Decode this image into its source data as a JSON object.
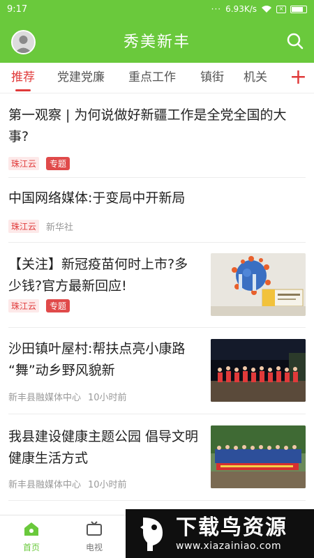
{
  "status": {
    "time": "9:17",
    "dots": "···",
    "network_speed": "6.93K/s",
    "sim_icon": "sim-x-icon",
    "battery_level": 0.85
  },
  "header": {
    "title": "秀美新丰",
    "avatar_icon": "avatar-icon",
    "search_icon": "search-icon"
  },
  "tabs": [
    {
      "label": "推荐",
      "active": true
    },
    {
      "label": "党建党廉",
      "active": false
    },
    {
      "label": "重点工作",
      "active": false
    },
    {
      "label": "镇街",
      "active": false
    },
    {
      "label": "机关",
      "active": false
    }
  ],
  "add_tab_label": "+",
  "articles": [
    {
      "title": "第一观察 | 为何说做好新疆工作是全党全国的大事?",
      "source": "珠江云",
      "tag": "专题"
    },
    {
      "title": "中国网络媒体:于变局中开新局",
      "source": "珠江云",
      "publisher": "新华社"
    },
    {
      "title": "【关注】新冠疫苗何时上市?多少钱?官方最新回应!",
      "source": "珠江云",
      "tag": "专题",
      "thumb_icon": "vaccine-image"
    },
    {
      "title": "沙田镇叶屋村:帮扶点亮小康路 “舞”动乡野风貌新",
      "publisher": "新丰县融媒体中心",
      "time": "10小时前",
      "thumb_icon": "night-dance-image"
    },
    {
      "title": "我县建设健康主题公园 倡导文明健康生活方式",
      "publisher": "新丰县融媒体中心",
      "time": "10小时前",
      "thumb_icon": "group-photo-image"
    }
  ],
  "bottom_nav": [
    {
      "label": "首页",
      "icon": "home-icon",
      "active": true
    },
    {
      "label": "电视",
      "icon": "tv-icon",
      "active": false
    }
  ],
  "watermark": {
    "big": "下载鸟资源",
    "url": "www.xiazainiao.com"
  },
  "colors": {
    "brand_green": "#6ac93c",
    "accent_red": "#e03a3a"
  }
}
